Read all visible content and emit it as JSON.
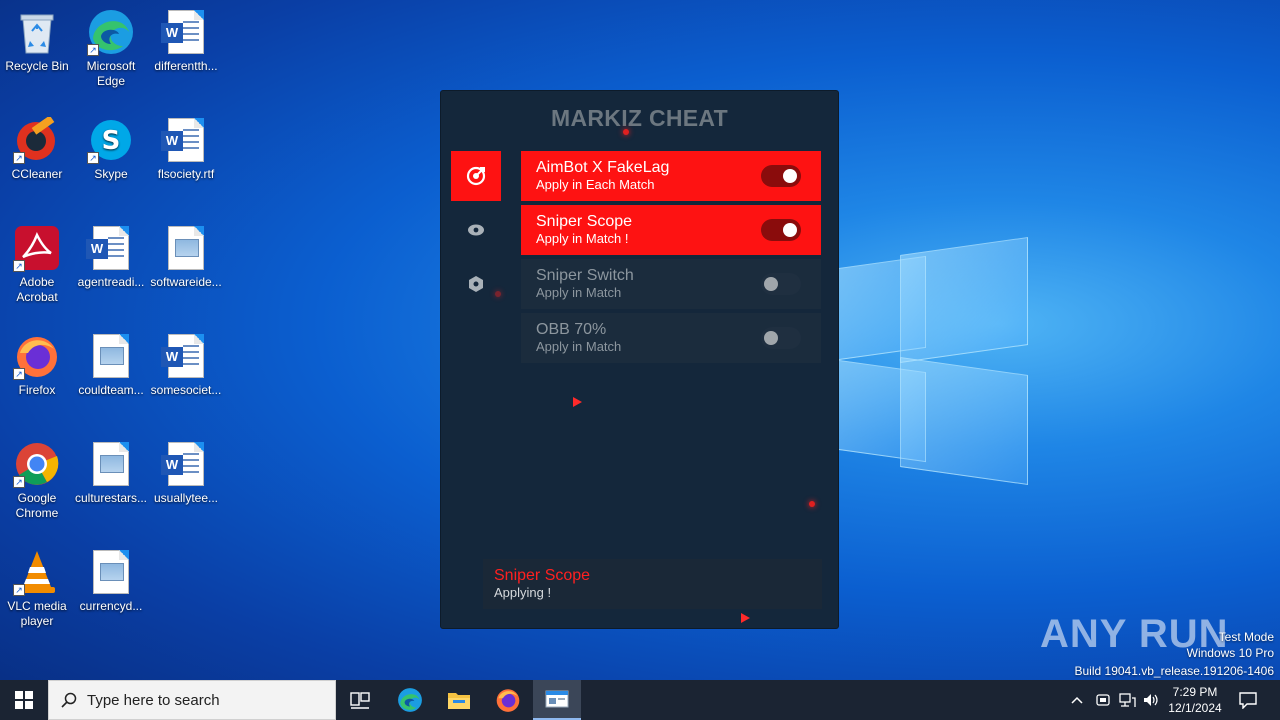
{
  "desktop": {
    "icons": [
      {
        "label": "Recycle Bin"
      },
      {
        "label": "Microsoft Edge"
      },
      {
        "label": "differentth..."
      },
      {
        "label": "CCleaner"
      },
      {
        "label": "Skype"
      },
      {
        "label": "flsociety.rtf"
      },
      {
        "label": "Adobe Acrobat"
      },
      {
        "label": "agentreadi..."
      },
      {
        "label": "softwareide..."
      },
      {
        "label": "Firefox"
      },
      {
        "label": "couldteam..."
      },
      {
        "label": "somesociet..."
      },
      {
        "label": "Google Chrome"
      },
      {
        "label": "culturestars..."
      },
      {
        "label": "usuallytee..."
      },
      {
        "label": "VLC media player"
      },
      {
        "label": "currencyd..."
      }
    ]
  },
  "cheat": {
    "title": "MARKIZ CHEAT",
    "features": [
      {
        "title": "AimBot X FakeLag",
        "subtitle": "Apply in Each Match",
        "enabled": true
      },
      {
        "title": "Sniper Scope",
        "subtitle": "Apply in Match !",
        "enabled": true
      },
      {
        "title": "Sniper Switch",
        "subtitle": "Apply in Match",
        "enabled": false
      },
      {
        "title": "OBB 70%",
        "subtitle": "Apply in Match",
        "enabled": false
      }
    ],
    "sidebar": [
      "target-icon",
      "eye-icon",
      "hexagon-icon"
    ],
    "status": {
      "title": "Sniper Scope",
      "message": "Applying !"
    },
    "accent": "#fe1212",
    "background": "#14273b"
  },
  "watermark": {
    "brand": "ANY RUN",
    "mode": "Test Mode",
    "os": "Windows 10 Pro",
    "build": "Build 19041.vb_release.191206-1406"
  },
  "taskbar": {
    "search_placeholder": "Type here to search",
    "time": "7:29 PM",
    "date": "12/1/2024"
  }
}
